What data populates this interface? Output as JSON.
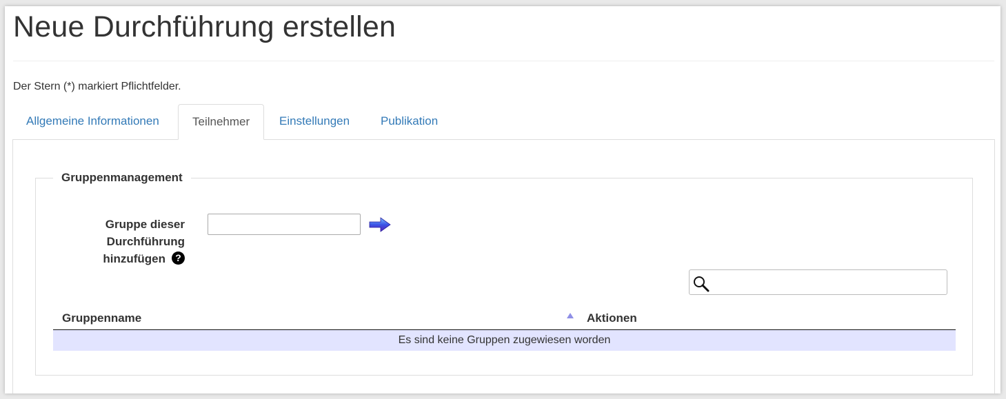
{
  "page": {
    "title": "Neue Durchführung erstellen",
    "required_note": "Der Stern (*) markiert Pflichtfelder."
  },
  "tabs": [
    {
      "label": "Allgemeine Informationen",
      "active": false
    },
    {
      "label": "Teilnehmer",
      "active": true
    },
    {
      "label": "Einstellungen",
      "active": false
    },
    {
      "label": "Publikation",
      "active": false
    }
  ],
  "group_management": {
    "legend": "Gruppenmanagement",
    "field_label_line1": "Gruppe dieser",
    "field_label_line2": "Durchführung",
    "field_label_line3": "hinzufügen",
    "help_icon": "question-circle-icon",
    "group_input_value": "",
    "add_icon": "arrow-right-icon",
    "search": {
      "icon": "search-icon",
      "value": ""
    },
    "table": {
      "columns": [
        "Gruppenname",
        "Aktionen"
      ],
      "sort_column": "Gruppenname",
      "sort_direction": "ascending",
      "empty_message": "Es sind keine Gruppen zugewiesen worden"
    }
  },
  "colors": {
    "link": "#337ab7",
    "empty_row_bg": "#e2e4ff",
    "arrow": "#3b2fd6"
  }
}
